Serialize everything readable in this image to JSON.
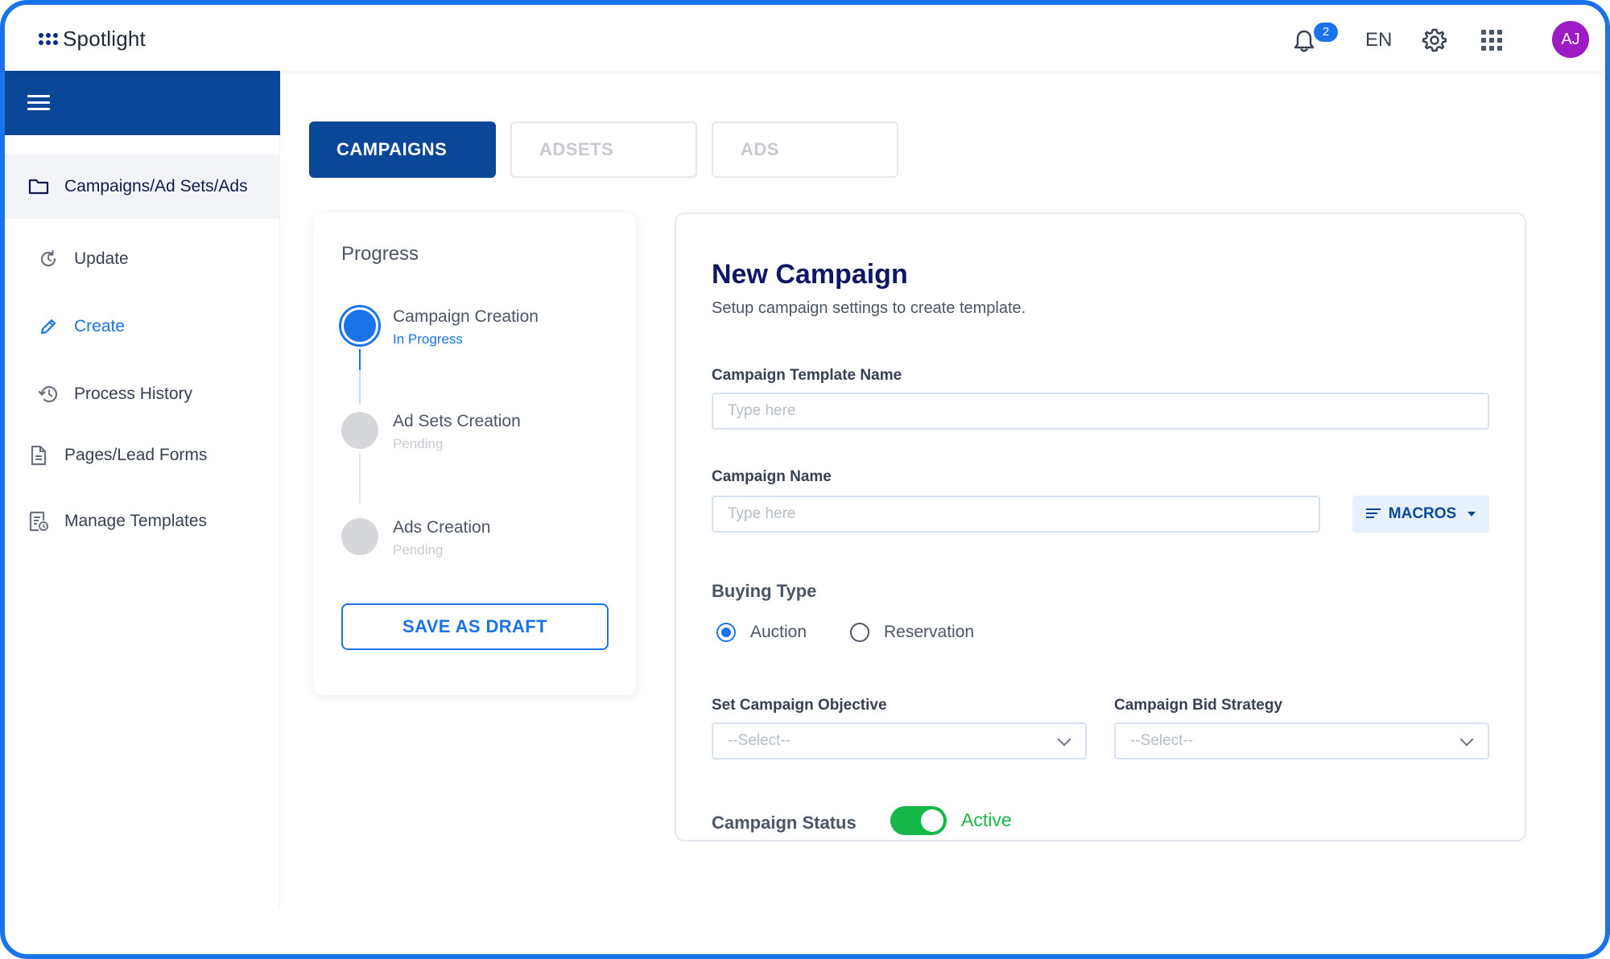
{
  "app": {
    "name": "Spotlight"
  },
  "header": {
    "notification_count": "2",
    "language": "EN",
    "avatar_initials": "AJ",
    "accent_color": "#1a73e8",
    "avatar_color": "#9c1bc4"
  },
  "sidebar": {
    "header_color": "#0b4799",
    "items": [
      {
        "label": "Campaigns/Ad Sets/Ads",
        "icon": "folder-icon",
        "active": true
      },
      {
        "label": "Update",
        "icon": "refresh-icon"
      },
      {
        "label": "Create",
        "icon": "pencil-icon"
      },
      {
        "label": "Process History",
        "icon": "history-icon"
      },
      {
        "label": "Pages/Lead Forms",
        "icon": "document-icon"
      },
      {
        "label": "Manage Templates",
        "icon": "template-icon"
      }
    ]
  },
  "tabs": [
    {
      "label": "CAMPAIGNS",
      "active": true
    },
    {
      "label": "ADSETS",
      "active": false
    },
    {
      "label": "ADS",
      "active": false
    }
  ],
  "progress": {
    "title": "Progress",
    "steps": [
      {
        "label": "Campaign Creation",
        "status": "In Progress"
      },
      {
        "label": "Ad Sets Creation",
        "status": "Pending"
      },
      {
        "label": "Ads Creation",
        "status": "Pending"
      }
    ],
    "save_draft_label": "SAVE AS DRAFT"
  },
  "form": {
    "title": "New Campaign",
    "subtitle": "Setup campaign settings to create template.",
    "template_name": {
      "label": "Campaign Template Name",
      "placeholder": "Type here",
      "value": ""
    },
    "campaign_name": {
      "label": "Campaign Name",
      "placeholder": "Type here",
      "value": ""
    },
    "macros_label": "MACROS",
    "buying_type": {
      "label": "Buying Type",
      "options": [
        "Auction",
        "Reservation"
      ],
      "selected": "Auction"
    },
    "objective": {
      "label": "Set Campaign Objective",
      "value": "--Select--"
    },
    "bid_strategy": {
      "label": "Campaign Bid Strategy",
      "value": "--Select--"
    },
    "status": {
      "label": "Campaign Status",
      "value": "Active",
      "on": true,
      "color": "#16b84a"
    }
  }
}
